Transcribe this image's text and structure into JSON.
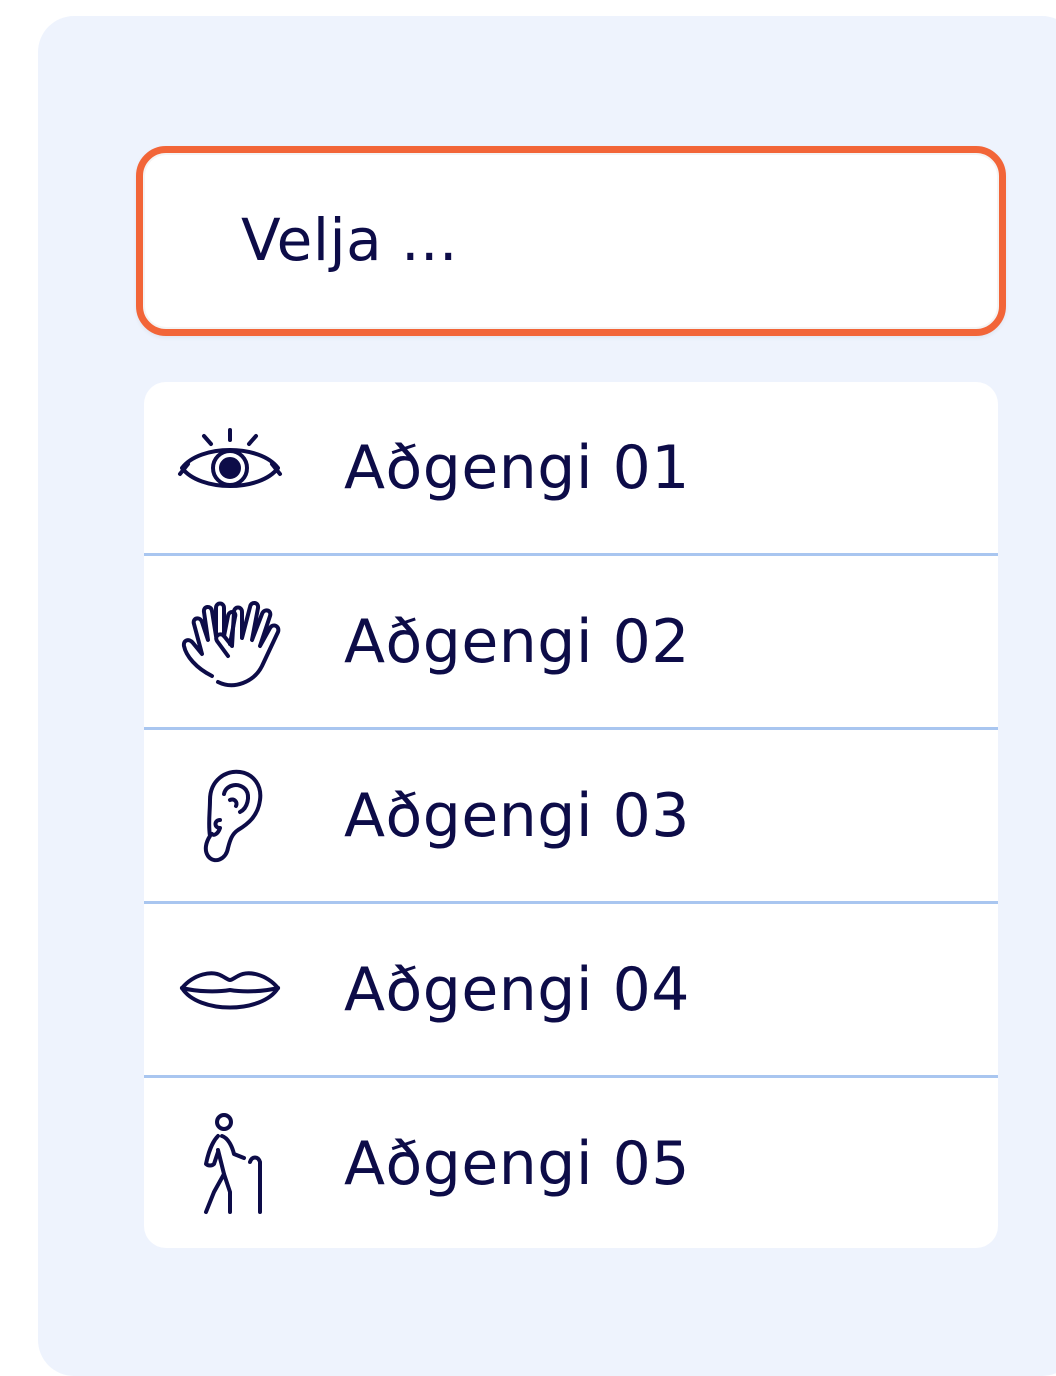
{
  "select": {
    "placeholder": "Velja ..."
  },
  "options": [
    {
      "label": "Aðgengi 01",
      "icon": "eye-icon"
    },
    {
      "label": "Aðgengi 02",
      "icon": "hands-icon"
    },
    {
      "label": "Aðgengi 03",
      "icon": "ear-icon"
    },
    {
      "label": "Aðgengi 04",
      "icon": "lips-icon"
    },
    {
      "label": "Aðgengi 05",
      "icon": "elderly-person-cane-icon"
    }
  ],
  "colors": {
    "panel_bg": "#eef3fd",
    "accent_border": "#f26538",
    "text": "#0d0c48",
    "divider": "#a9c6f0"
  }
}
